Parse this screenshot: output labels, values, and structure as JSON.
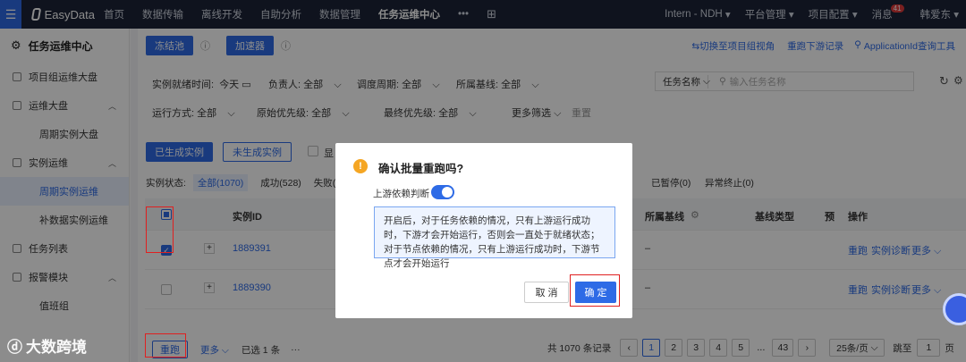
{
  "topnav": {
    "logo": "EasyData",
    "items": [
      "首页",
      "数据传输",
      "离线开发",
      "自助分析",
      "数据管理",
      "任务运维中心"
    ],
    "more": "•••",
    "env": "Intern - NDH",
    "platform": "平台管理",
    "project_config": "项目配置",
    "messages": "消息",
    "message_count": "41",
    "user": "韩爱东"
  },
  "sidebar": {
    "title": "任务运维中心",
    "items": [
      {
        "label": "项目组运维大盘",
        "type": "top"
      },
      {
        "label": "运维大盘",
        "type": "top"
      },
      {
        "label": "周期实例大盘",
        "type": "sub"
      },
      {
        "label": "实例运维",
        "type": "top"
      },
      {
        "label": "周期实例运维",
        "type": "sub"
      },
      {
        "label": "补数据实例运维",
        "type": "sub"
      },
      {
        "label": "任务列表",
        "type": "top"
      },
      {
        "label": "报警模块",
        "type": "top"
      },
      {
        "label": "值班组",
        "type": "sub"
      }
    ]
  },
  "toolbar": {
    "freeze_pool": "冻结池",
    "accelerator": "加速器",
    "switch_view": "⇆切换至项目组视角",
    "rerun_record": "重跑下游记录",
    "appid_query": "ApplicationId查询工具"
  },
  "filters": {
    "ready_time_label": "实例就绪时间:",
    "ready_time_value": "今天",
    "owner_label": "负责人:",
    "owner_value": "全部",
    "period_label": "调度周期:",
    "period_value": "全部",
    "baseline_label": "所属基线:",
    "baseline_value": "全部",
    "task_name_label": "任务名称",
    "task_name_placeholder": "输入任务名称",
    "run_mode_label": "运行方式:",
    "run_mode_value": "全部",
    "orig_priority_label": "原始优先级:",
    "orig_priority_value": "全部",
    "final_priority_label": "最终优先级:",
    "final_priority_value": "全部",
    "more_filters": "更多筛选",
    "reset": "重置"
  },
  "instance_tabs": {
    "generated": "已生成实例",
    "not_generated": "未生成实例",
    "show_label": "显"
  },
  "status": {
    "label": "实例状态:",
    "all": "全部(1070)",
    "success": "成功(528)",
    "failed": "失败(",
    "paused": "已暂停(0)",
    "abnormal": "异常终止(0)"
  },
  "table": {
    "col_id": "实例ID",
    "col_baseline": "所属基线",
    "col_baseline_type": "基线类型",
    "col_pre": "预",
    "col_ops": "操作",
    "rows": [
      {
        "id": "1889391",
        "baseline": "–",
        "checked": true
      },
      {
        "id": "1889390",
        "baseline": "–",
        "checked": false
      }
    ],
    "row_ops": {
      "rerun": "重跑",
      "diagnose": "实例诊断",
      "more": "更多"
    }
  },
  "footer": {
    "rerun": "重跑",
    "more": "更多",
    "selected": "已选 1 条",
    "dots": "···",
    "total": "共 1070 条记录",
    "pages": [
      "1",
      "2",
      "3",
      "4",
      "5"
    ],
    "ellipsis": "...",
    "last_page": "43",
    "page_size": "25条/页",
    "jump_label": "跳至",
    "jump_value": "1",
    "page_unit": "页"
  },
  "modal": {
    "title": "确认批量重跑吗?",
    "toggle_label": "上游依赖判断",
    "toggle_on": true,
    "info": "开启后，对于任务依赖的情况，只有上游运行成功时，下游才会开始运行，否则会一直处于就绪状态；对于节点依赖的情况，只有上游运行成功时，下游节点才会开始运行",
    "cancel": "取 消",
    "ok": "确 定"
  },
  "watermark_text": "大数跨境"
}
